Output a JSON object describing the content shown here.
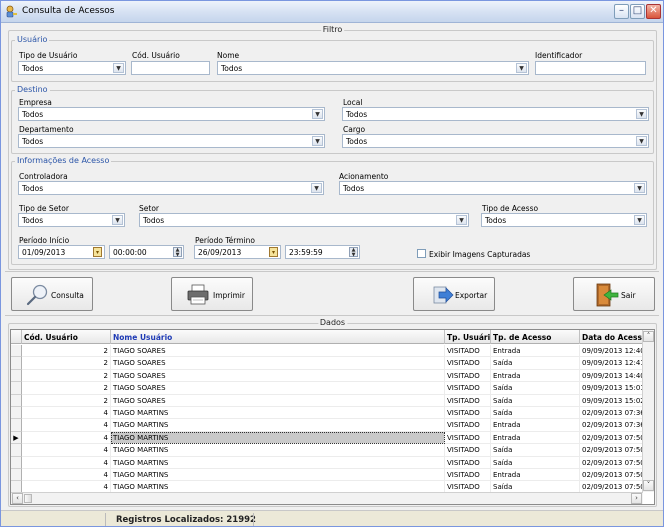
{
  "window": {
    "title": "Consulta de Acessos"
  },
  "filtro": {
    "title": "Filtro",
    "usuario": {
      "title": "Usuário",
      "tipo_usuario_label": "Tipo de Usuário",
      "tipo_usuario_value": "Todos",
      "cod_usuario_label": "Cód. Usuário",
      "cod_usuario_value": "",
      "nome_label": "Nome",
      "nome_value": "Todos",
      "identificador_label": "Identificador",
      "identificador_value": ""
    },
    "destino": {
      "title": "Destino",
      "empresa_label": "Empresa",
      "empresa_value": "Todos",
      "local_label": "Local",
      "local_value": "Todos",
      "departamento_label": "Departamento",
      "departamento_value": "Todos",
      "cargo_label": "Cargo",
      "cargo_value": "Todos"
    },
    "informacoes": {
      "title": "Informações de Acesso",
      "controladora_label": "Controladora",
      "controladora_value": "Todos",
      "acionamento_label": "Acionamento",
      "acionamento_value": "Todos",
      "tipo_setor_label": "Tipo de Setor",
      "tipo_setor_value": "Todos",
      "setor_label": "Setor",
      "setor_value": "Todos",
      "tipo_acesso_label": "Tipo de Acesso",
      "tipo_acesso_value": "Todos",
      "periodo_inicio_label": "Período Início",
      "periodo_inicio_date": "01/09/2013",
      "periodo_inicio_time": "00:00:00",
      "periodo_termino_label": "Período Término",
      "periodo_termino_date": "26/09/2013",
      "periodo_termino_time": "23:59:59",
      "exibir_imagens_label": "Exibir Imagens Capturadas"
    }
  },
  "actions": {
    "consulta": "Consulta",
    "imprimir": "Imprimir",
    "exportar": "Exportar",
    "sair": "Sair"
  },
  "dados": {
    "title": "Dados",
    "columns": [
      "Cód. Usuário",
      "Nome Usuário",
      "Tp. Usuário",
      "Tp. de Acesso",
      "Data do Acesso"
    ],
    "rows": [
      [
        "2",
        "TIAGO SOARES",
        "VISITADO",
        "Entrada",
        "09/09/2013 12:40"
      ],
      [
        "2",
        "TIAGO SOARES",
        "VISITADO",
        "Saída",
        "09/09/2013 12:41"
      ],
      [
        "2",
        "TIAGO SOARES",
        "VISITADO",
        "Entrada",
        "09/09/2013 14:40"
      ],
      [
        "2",
        "TIAGO SOARES",
        "VISITADO",
        "Saída",
        "09/09/2013 15:01"
      ],
      [
        "2",
        "TIAGO SOARES",
        "VISITADO",
        "Saída",
        "09/09/2013 15:02"
      ],
      [
        "4",
        "TIAGO MARTINS",
        "VISITADO",
        "Saída",
        "02/09/2013 07:36"
      ],
      [
        "4",
        "TIAGO MARTINS",
        "VISITADO",
        "Entrada",
        "02/09/2013 07:36"
      ],
      [
        "4",
        "TIAGO MARTINS",
        "VISITADO",
        "Entrada",
        "02/09/2013 07:50"
      ],
      [
        "4",
        "TIAGO MARTINS",
        "VISITADO",
        "Saída",
        "02/09/2013 07:50"
      ],
      [
        "4",
        "TIAGO MARTINS",
        "VISITADO",
        "Saída",
        "02/09/2013 07:50"
      ],
      [
        "4",
        "TIAGO MARTINS",
        "VISITADO",
        "Entrada",
        "02/09/2013 07:50"
      ],
      [
        "4",
        "TIAGO MARTINS",
        "VISITADO",
        "Saída",
        "02/09/2013 07:50"
      ]
    ],
    "selected_row": 7
  },
  "status": {
    "registros": "Registros Localizados: 21992"
  }
}
